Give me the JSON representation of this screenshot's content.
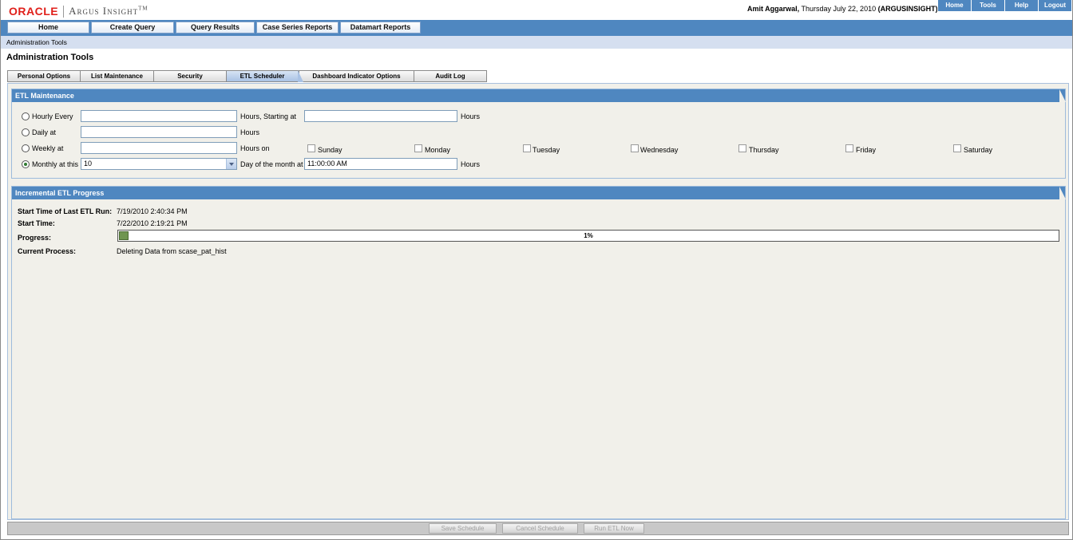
{
  "brand": {
    "oracle": "ORACLE",
    "product": "Argus Insight",
    "tm": "TM"
  },
  "user": {
    "name": "Amit Aggarwal,",
    "date": " Thursday July 22, 2010 ",
    "db": "(ARGUSINSIGHT)"
  },
  "global_links": [
    "Home",
    "Tools",
    "Help",
    "Logout"
  ],
  "nav": [
    "Home",
    "Create Query",
    "Query Results",
    "Case Series Reports",
    "Datamart Reports"
  ],
  "breadcrumb": "Administration Tools",
  "page_title": "Administration Tools",
  "tabs": [
    "Personal Options",
    "List Maintenance",
    "Security",
    "ETL Scheduler",
    "Dashboard Indicator Options",
    "Audit Log"
  ],
  "active_tab": "ETL Scheduler",
  "etl_maintenance": {
    "title": "ETL Maintenance",
    "hourly": {
      "label": "Hourly Every",
      "value": "",
      "unit": "Hours, Starting at",
      "start_value": "",
      "start_unit": "Hours"
    },
    "daily": {
      "label": "Daily at",
      "value": "",
      "unit": "Hours"
    },
    "weekly": {
      "label": "Weekly at",
      "value": "",
      "unit": "Hours on",
      "days": [
        "Sunday",
        "Monday",
        "Tuesday",
        "Wednesday",
        "Thursday",
        "Friday",
        "Saturday"
      ]
    },
    "monthly": {
      "label": "Monthly at this",
      "selected": "10",
      "unit": "Day of the month at",
      "time_value": "11:00:00 AM",
      "time_unit": "Hours"
    },
    "selected_option": "monthly"
  },
  "progress_section": {
    "title": "Incremental ETL Progress",
    "last_run_label": "Start Time of Last ETL Run:",
    "last_run_value": "7/19/2010 2:40:34 PM",
    "start_time_label": "Start Time:",
    "start_time_value": "7/22/2010 2:19:21 PM",
    "progress_label": "Progress:",
    "progress_text": "1%",
    "progress_fraction": 0.01,
    "current_process_label": "Current Process:",
    "current_process_value": "Deleting Data from scase_pat_hist"
  },
  "footer_buttons": [
    "Save Schedule",
    "Cancel Schedule",
    "Run ETL Now"
  ]
}
